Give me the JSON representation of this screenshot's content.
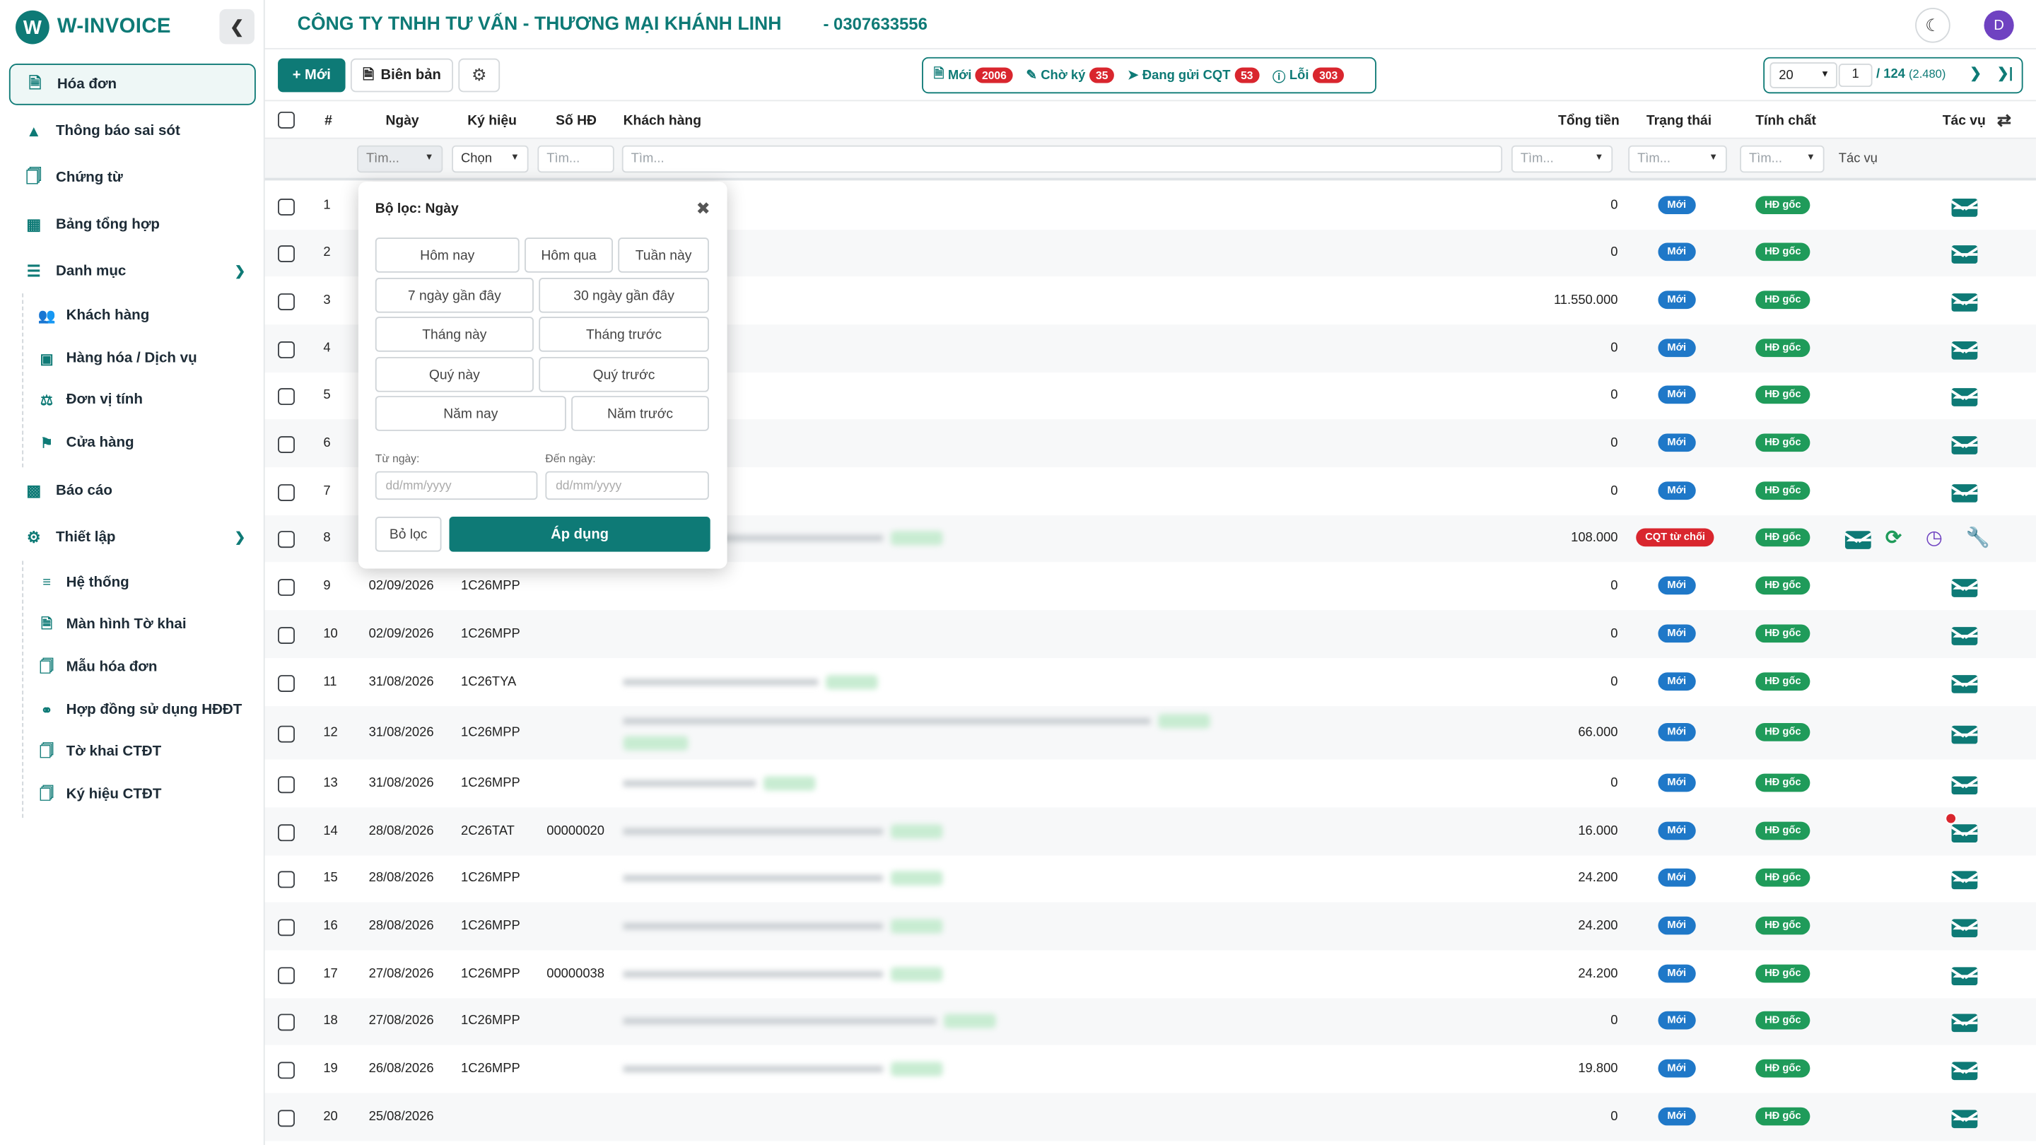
{
  "brand": {
    "name": "W-INVOICE",
    "logo_letter": "W"
  },
  "header": {
    "company": "CÔNG TY TNHH TƯ VẤN - THƯƠNG MẠI KHÁNH LINH",
    "taxcode": "- 0307633556",
    "avatar": "D"
  },
  "sidebar": {
    "items": [
      {
        "label": "Hóa đơn",
        "icon": "document-icon"
      },
      {
        "label": "Thông báo sai sót",
        "icon": "warning-icon"
      },
      {
        "label": "Chứng từ",
        "icon": "file-icon"
      },
      {
        "label": "Bảng tổng hợp",
        "icon": "table-icon"
      },
      {
        "label": "Danh mục",
        "icon": "list-icon"
      },
      {
        "label": "Báo cáo",
        "icon": "bar-chart-icon"
      },
      {
        "label": "Thiết lập",
        "icon": "settings-icon"
      }
    ],
    "danh_muc_sub": [
      "Khách hàng",
      "Hàng hóa / Dịch vụ",
      "Đơn vị tính",
      "Cửa hàng"
    ],
    "thiet_lap_sub": [
      "Hệ thống",
      "Màn hình Tờ khai",
      "Mẫu hóa đơn",
      "Hợp đồng sử dụng HĐĐT",
      "Tờ khai CTĐT",
      "Ký hiệu CTĐT"
    ]
  },
  "toolbar": {
    "new_label": "Mới",
    "report_label": "Biên bản"
  },
  "status": [
    {
      "label": "Mới",
      "count": "2006"
    },
    {
      "label": "Chờ ký",
      "count": "35"
    },
    {
      "label": "Đang gửi CQT",
      "count": "53"
    },
    {
      "label": "Lỗi",
      "count": "303"
    }
  ],
  "pager": {
    "page_size": "20",
    "page": "1",
    "total": "/ 124",
    "records": "(2.480)"
  },
  "table": {
    "headers": {
      "num": "#",
      "date": "Ngày",
      "symbol": "Ký hiệu",
      "number": "Số HĐ",
      "customer": "Khách hàng",
      "total": "Tổng tiền",
      "status": "Trạng thái",
      "nature": "Tính chất",
      "actions": "Tác vụ"
    },
    "filters": {
      "date": "Tìm...",
      "symbol": "Chọn",
      "number": "Tìm...",
      "customer": "Tìm...",
      "total": "Tìm...",
      "status": "Tìm...",
      "nature": "Tìm...",
      "actions": "Tác vụ"
    },
    "rows": [
      {
        "n": "1",
        "date": "",
        "sym": "",
        "num": "",
        "total": "0",
        "status": "Mới",
        "nature": "HĐ gốc"
      },
      {
        "n": "2",
        "date": "",
        "sym": "",
        "num": "",
        "total": "0",
        "status": "Mới",
        "nature": "HĐ gốc"
      },
      {
        "n": "3",
        "date": "",
        "sym": "",
        "num": "",
        "total": "11.550.000",
        "status": "Mới",
        "nature": "HĐ gốc"
      },
      {
        "n": "4",
        "date": "",
        "sym": "",
        "num": "",
        "total": "0",
        "status": "Mới",
        "nature": "HĐ gốc"
      },
      {
        "n": "5",
        "date": "",
        "sym": "",
        "num": "",
        "total": "0",
        "status": "Mới",
        "nature": "HĐ gốc"
      },
      {
        "n": "6",
        "date": "",
        "sym": "",
        "num": "",
        "total": "0",
        "status": "Mới",
        "nature": "HĐ gốc"
      },
      {
        "n": "7",
        "date": "",
        "sym": "",
        "num": "",
        "total": "0",
        "status": "Mới",
        "nature": "HĐ gốc"
      },
      {
        "n": "8",
        "date": "",
        "sym": "",
        "num": "",
        "total": "108.000",
        "status": "CQT từ chối",
        "nature": "HĐ gốc"
      },
      {
        "n": "9",
        "date": "02/09/2026",
        "sym": "1C26MPP",
        "num": "",
        "total": "0",
        "status": "Mới",
        "nature": "HĐ gốc"
      },
      {
        "n": "10",
        "date": "02/09/2026",
        "sym": "1C26MPP",
        "num": "",
        "total": "0",
        "status": "Mới",
        "nature": "HĐ gốc"
      },
      {
        "n": "11",
        "date": "31/08/2026",
        "sym": "1C26TYA",
        "num": "",
        "total": "0",
        "status": "Mới",
        "nature": "HĐ gốc"
      },
      {
        "n": "12",
        "date": "31/08/2026",
        "sym": "1C26MPP",
        "num": "",
        "total": "66.000",
        "status": "Mới",
        "nature": "HĐ gốc"
      },
      {
        "n": "13",
        "date": "31/08/2026",
        "sym": "1C26MPP",
        "num": "",
        "total": "0",
        "status": "Mới",
        "nature": "HĐ gốc"
      },
      {
        "n": "14",
        "date": "28/08/2026",
        "sym": "2C26TAT",
        "num": "00000020",
        "total": "16.000",
        "status": "Mới",
        "nature": "HĐ gốc"
      },
      {
        "n": "15",
        "date": "28/08/2026",
        "sym": "1C26MPP",
        "num": "",
        "total": "24.200",
        "status": "Mới",
        "nature": "HĐ gốc"
      },
      {
        "n": "16",
        "date": "28/08/2026",
        "sym": "1C26MPP",
        "num": "",
        "total": "24.200",
        "status": "Mới",
        "nature": "HĐ gốc"
      },
      {
        "n": "17",
        "date": "27/08/2026",
        "sym": "1C26MPP",
        "num": "00000038",
        "total": "24.200",
        "status": "Mới",
        "nature": "HĐ gốc"
      },
      {
        "n": "18",
        "date": "27/08/2026",
        "sym": "1C26MPP",
        "num": "",
        "total": "0",
        "status": "Mới",
        "nature": "HĐ gốc"
      },
      {
        "n": "19",
        "date": "26/08/2026",
        "sym": "1C26MPP",
        "num": "",
        "total": "19.800",
        "status": "Mới",
        "nature": "HĐ gốc"
      },
      {
        "n": "20",
        "date": "25/08/2026",
        "sym": "",
        "num": "",
        "total": "0",
        "status": "Mới",
        "nature": "HĐ gốc"
      }
    ]
  },
  "popup": {
    "title": "Bộ lọc: Ngày",
    "quick": [
      "Hôm nay",
      "Hôm qua",
      "Tuần này",
      "7 ngày gần đây",
      "30 ngày gần đây",
      "Tháng này",
      "Tháng trước",
      "Quý này",
      "Quý trước",
      "Năm nay",
      "Năm trước"
    ],
    "from_label": "Từ ngày:",
    "to_label": "Đến ngày:",
    "date_placeholder": "dd/mm/yyyy",
    "reset_label": "Bỏ lọc",
    "apply_label": "Áp dụng"
  },
  "colors": {
    "primary": "#0e7a76",
    "new": "#1f78c8",
    "original": "#1f9b5a",
    "error": "#d9262e"
  }
}
